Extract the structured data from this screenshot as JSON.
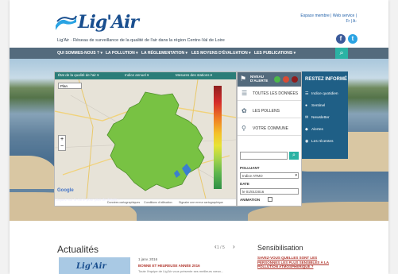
{
  "header": {
    "logo_text": "Lig'Air",
    "tagline": "Lig'Air · Réseau de surveillance de la qualité de l'air dans la région Centre-Val de Loire",
    "top_links": [
      "Espace membre",
      "Web service",
      "Fr",
      "|",
      "A-"
    ],
    "social": [
      "f",
      "t"
    ]
  },
  "nav": {
    "items": [
      "QUI SOMMES-NOUS ? ▾",
      "LA POLLUTION ▾",
      "LA RÉGLEMENTATION ▾",
      "LES MOYENS D'ÉVALUATION ▾",
      "LES PUBLICATIONS ▾"
    ],
    "search_icon": "search-icon"
  },
  "map": {
    "tabs": [
      "État de la qualité de l'air ▾",
      "Indice annuel ▾",
      "Mesures des stations ▾"
    ],
    "plan_select": "Plan",
    "zoom": [
      "+",
      "−"
    ],
    "google": "Google",
    "footer": [
      "Données cartographiques",
      "Conditions d'utilisation",
      "Signaler une erreur cartographique"
    ],
    "caption": "Cliquez sur la carte pour plus de détails ›"
  },
  "panel": {
    "niveau_label": "NIVEAU D'ALERTE",
    "niveau_colors": [
      "#4db84a",
      "#d94c35",
      "#8f1d1d"
    ],
    "items": [
      {
        "icon": "list-icon",
        "label": "TOUTES LES DONNÉES"
      },
      {
        "icon": "flower-icon",
        "label": "LES POLLENS"
      },
      {
        "icon": "location-pin-icon",
        "label": "VOTRE COMMUNE"
      }
    ],
    "search_icon": "search-icon",
    "polluant_label": "POLLUANT",
    "polluant_value": "Indice ATMO",
    "date_label": "DATE",
    "date_value": "le 01/01/2016",
    "animation_label": "ANIMATION"
  },
  "restez": {
    "title": "RESTEZ INFORMÉ",
    "items": [
      {
        "icon": "list-icon",
        "label": "Indice quotidien"
      },
      {
        "icon": "bulb-icon",
        "label": "Sentinel"
      },
      {
        "icon": "newsletter-icon",
        "label": "Newsletter"
      },
      {
        "icon": "alert-icon",
        "label": "Alertes"
      },
      {
        "icon": "rss-icon",
        "label": "Les récentes"
      }
    ]
  },
  "actualites": {
    "title": "Actualités",
    "pager": "1 / 5",
    "prev": "‹",
    "next": "›",
    "image_logo": "Lig'Air",
    "date": "1 janv. 2016",
    "headline": "BONNE ET HEUREUSE ANNÉE 2016",
    "text": "Toute l'équipe de Lig'Air vous présente ses meilleurs vœux..."
  },
  "sensibilisation": {
    "title": "Sensibilisation",
    "text": "SAVEZ-VOUS QUELLES SONT LES PERSONNES LES PLUS SENSIBLES À LA POLLUTION ATMOSPHÉRIQUE ?"
  },
  "colors": {
    "nav": "#546b7d",
    "accent": "#2bb3a4",
    "restez": "#1f5f86",
    "region": "#78c243"
  }
}
